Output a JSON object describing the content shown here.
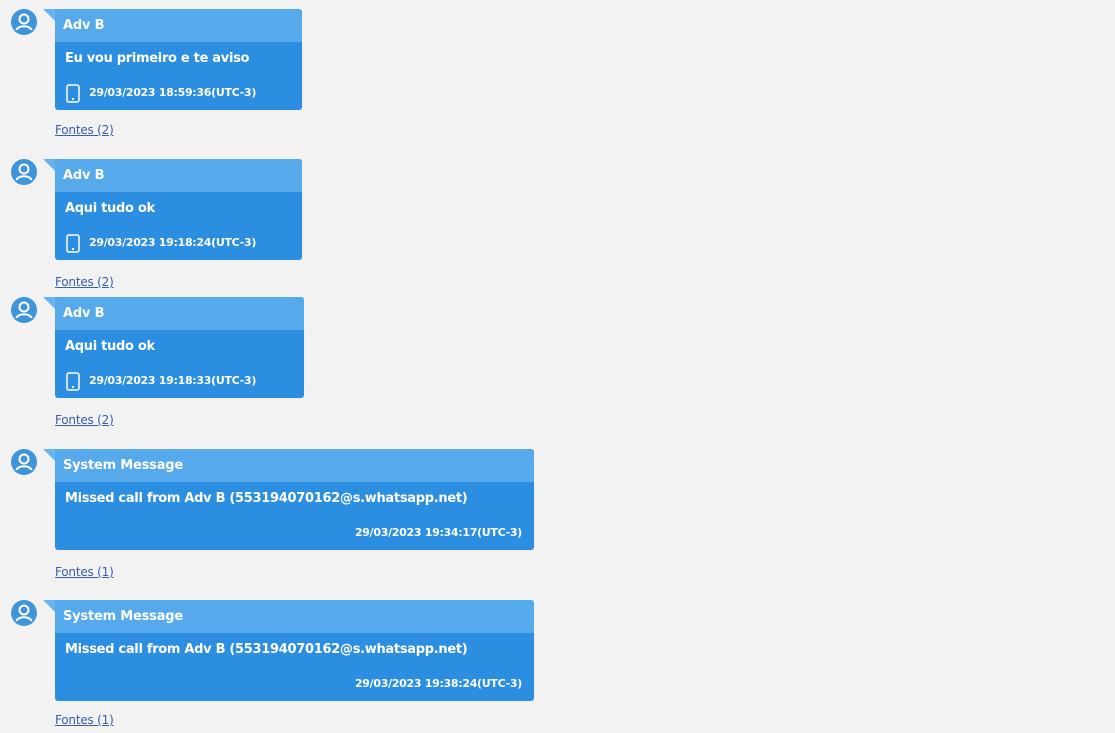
{
  "messages": [
    {
      "sender": "Adv B",
      "text": "Eu vou primeiro e te aviso",
      "timestamp": "29/03/2023 18:59:36(UTC-3)",
      "device_icon": "phone-icon",
      "sources_label": "Fontes (2)"
    },
    {
      "sender": "Adv B",
      "text": "Aqui tudo ok",
      "timestamp": "29/03/2023 19:18:24(UTC-3)",
      "device_icon": "phone-icon",
      "sources_label": "Fontes (2)"
    },
    {
      "sender": "Adv B",
      "text": "Aqui tudo ok",
      "timestamp": "29/03/2023 19:18:33(UTC-3)",
      "device_icon": "phone-icon",
      "sources_label": "Fontes (2)"
    },
    {
      "sender": "System Message",
      "text": "Missed call from Adv B (553194070162@s.whatsapp.net)",
      "timestamp": "29/03/2023 19:34:17(UTC-3)",
      "sources_label": "Fontes (1)"
    },
    {
      "sender": "System Message",
      "text": "Missed call from Adv B (553194070162@s.whatsapp.net)",
      "timestamp": "29/03/2023 19:38:24(UTC-3)",
      "sources_label": "Fontes (1)"
    }
  ],
  "colors": {
    "page_background": "#f2f2f2",
    "bubble": "#2b8ee0",
    "bubble_header": "#56aaeb",
    "avatar": "#3f95d9",
    "link": "#3a5fa8"
  }
}
